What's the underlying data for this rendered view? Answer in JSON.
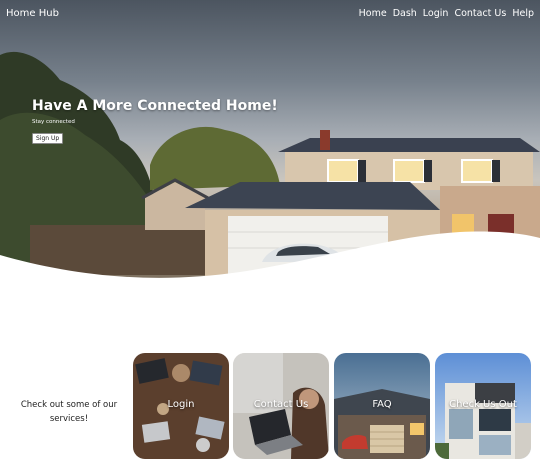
{
  "nav": {
    "brand": "Home Hub",
    "links": [
      "Home",
      "Dash",
      "Login",
      "Contact Us",
      "Help"
    ]
  },
  "hero": {
    "title": "Have A More Connected Home!",
    "subtitle": "Stay connected",
    "button_label": "Sign Up"
  },
  "services": {
    "intro": "Check out some of our services!",
    "cards": [
      {
        "label": "Login",
        "image": "hands-laptops-table-photo"
      },
      {
        "label": "Contact Us",
        "image": "person-laptop-photo"
      },
      {
        "label": "FAQ",
        "image": "house-garage-dusk-photo"
      },
      {
        "label": "Check Us Out",
        "image": "modern-house-photo"
      }
    ]
  },
  "colors": {
    "nav_text": "#ffffff",
    "page_background": "#ffffff"
  }
}
